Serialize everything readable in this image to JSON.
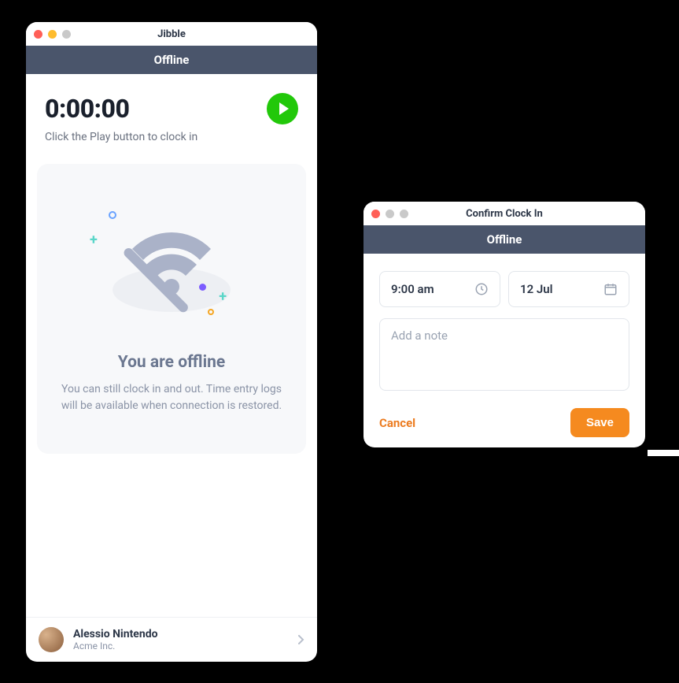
{
  "left": {
    "title": "Jibble",
    "banner": "Offline",
    "timer": "0:00:00",
    "hint": "Click the Play button to clock in",
    "offline_heading": "You are offline",
    "offline_body": "You can still clock in and out. Time entry logs will be available when connection is restored.",
    "user_name": "Alessio Nintendo",
    "user_company": "Acme Inc."
  },
  "right": {
    "title": "Confirm Clock In",
    "banner": "Offline",
    "time_value": "9:00 am",
    "date_value": "12 Jul",
    "note_placeholder": "Add a note",
    "cancel": "Cancel",
    "save": "Save"
  },
  "colors": {
    "accent_green": "#22c80a",
    "accent_orange": "#f58a1f",
    "banner_bg": "#4a556b"
  }
}
